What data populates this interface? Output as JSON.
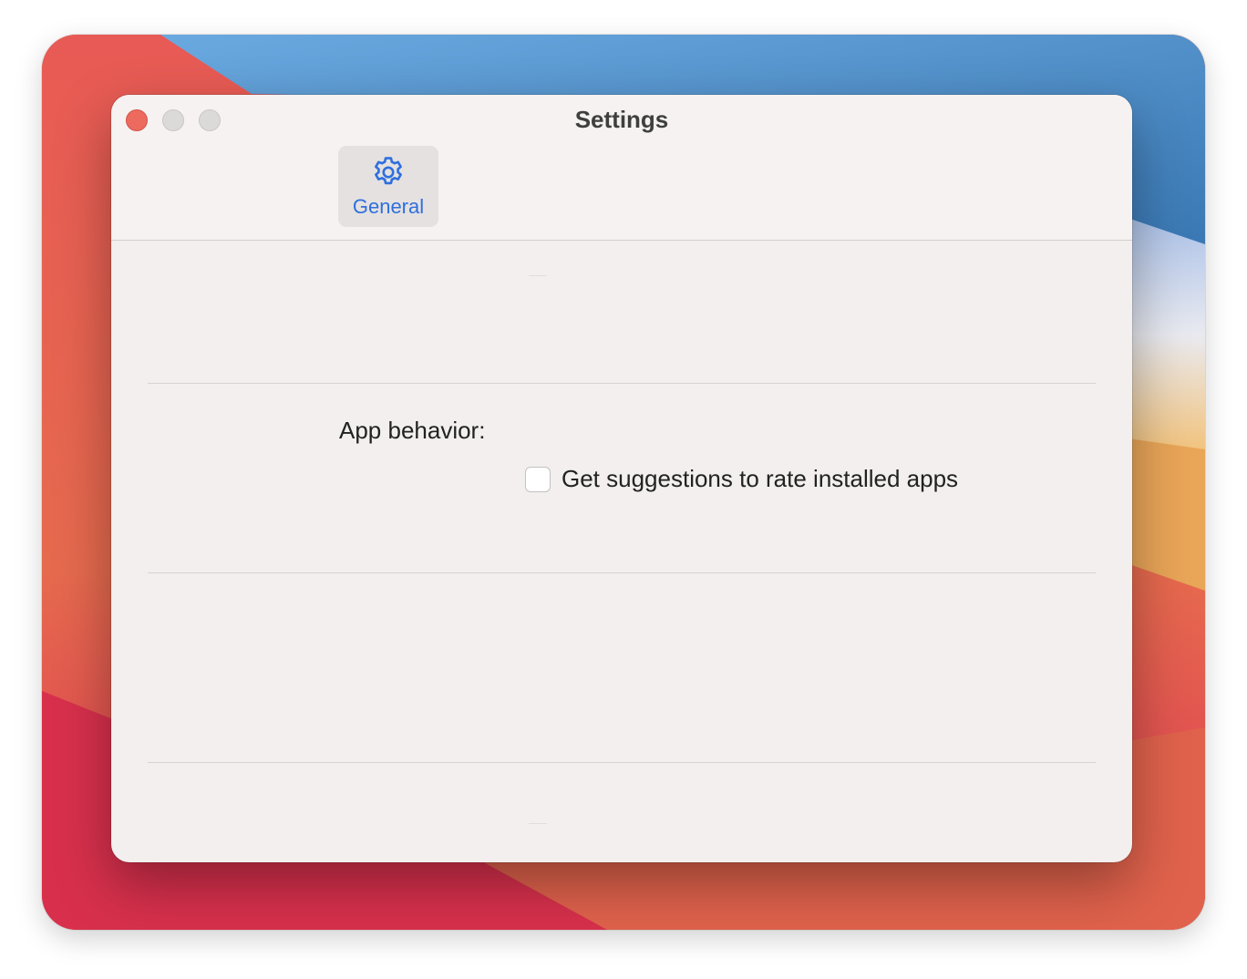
{
  "window": {
    "title": "Settings"
  },
  "toolbar": {
    "tabs": [
      {
        "label": "General",
        "icon": "gear-icon",
        "selected": true
      }
    ]
  },
  "general": {
    "app_behavior_label": "App behavior:",
    "rate_suggestions": {
      "label": "Get suggestions to rate installed apps",
      "checked": false
    }
  },
  "colors": {
    "accent": "#2f6fde",
    "close": "#ec6a5e",
    "window_bg": "#f2efee"
  }
}
